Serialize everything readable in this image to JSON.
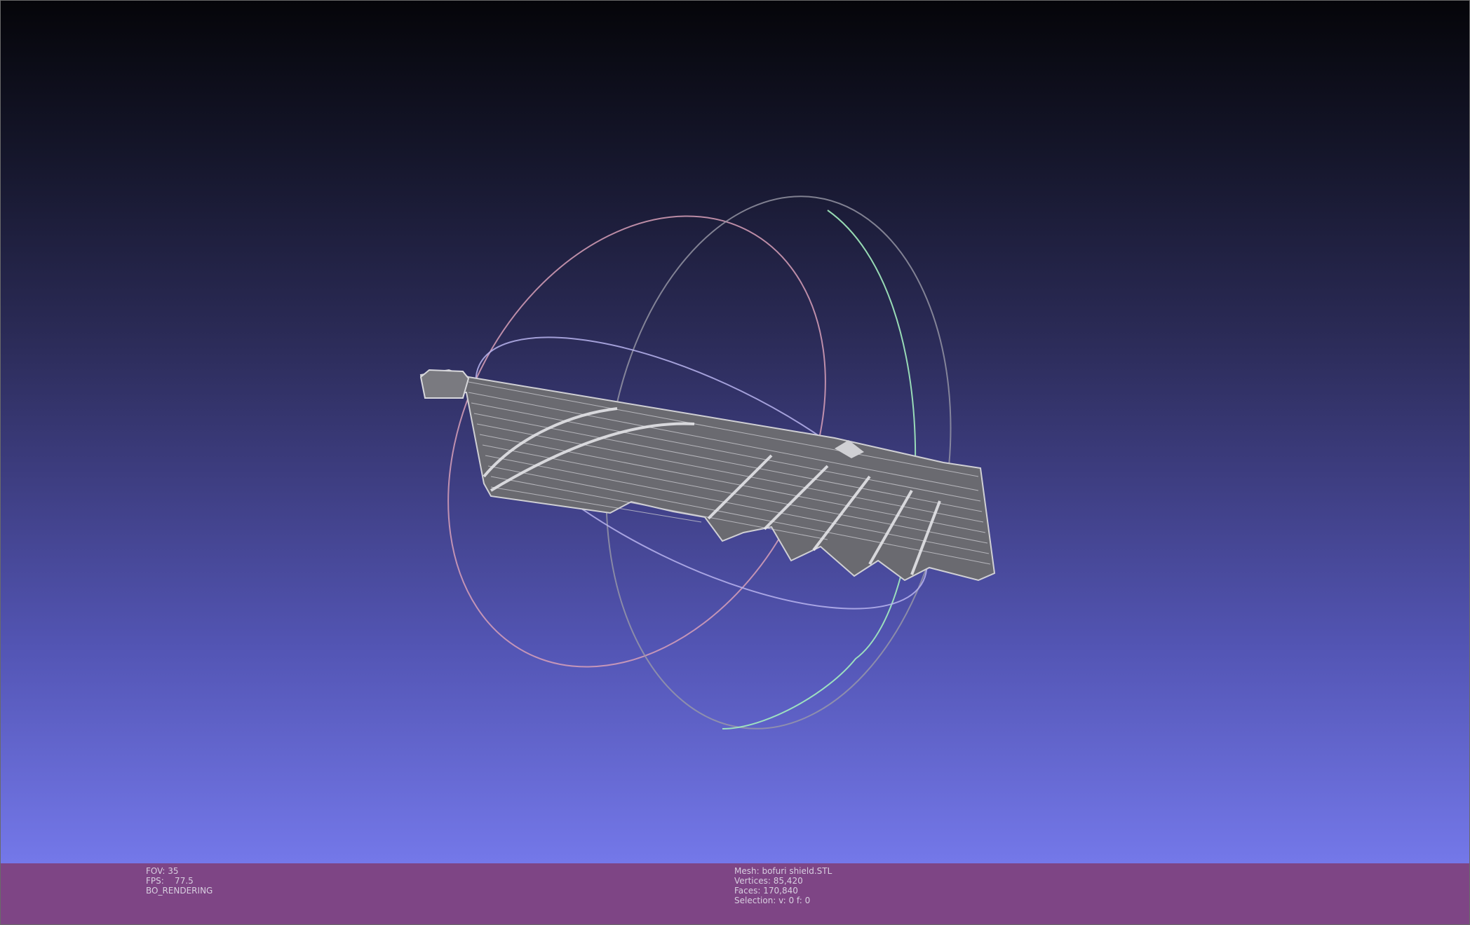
{
  "status_left": {
    "fov": "FOV: 35",
    "fps": "FPS:    77.5",
    "render_mode": "BO_RENDERING"
  },
  "status_mesh": {
    "mesh": "Mesh: bofuri shield.STL",
    "vertices": "Vertices: 85,420",
    "faces": "Faces: 170,840",
    "selection": "Selection: v: 0 f: 0"
  },
  "colors": {
    "background_top": "#050509",
    "background_bottom": "#7478e9",
    "info_bar": "#7e4585",
    "mesh_wire": "#c8c8c8",
    "trackball_red": "#e8a6c0",
    "trackball_green": "#9ee8b4",
    "trackball_blue": "#c6c2f2"
  }
}
